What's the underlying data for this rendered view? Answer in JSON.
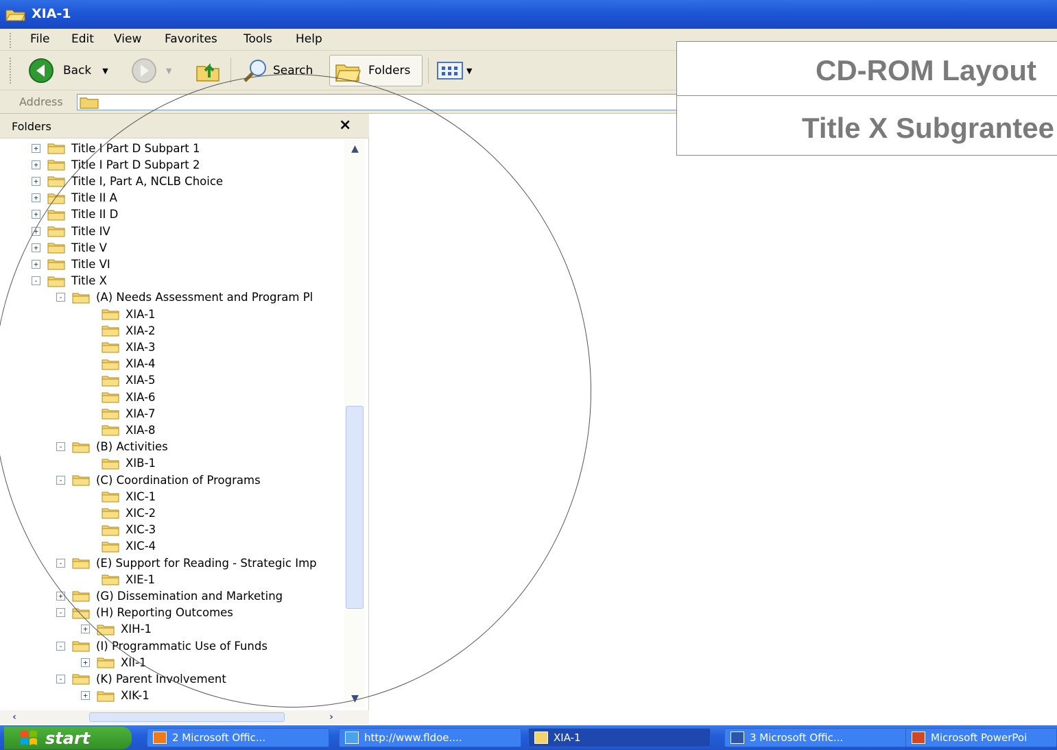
{
  "window": {
    "title": "XIA-1"
  },
  "menu": [
    "File",
    "Edit",
    "View",
    "Favorites",
    "Tools",
    "Help"
  ],
  "toolbar": {
    "back": "Back",
    "search": "Search",
    "folders": "Folders"
  },
  "address": {
    "label": "Address",
    "value": ""
  },
  "folders_pane": {
    "title": "Folders",
    "close": "×"
  },
  "tree": [
    {
      "label": "Title I Part D Subpart 1",
      "level": 0,
      "expander": "+"
    },
    {
      "label": "Title I Part D Subpart 2",
      "level": 0,
      "expander": "+"
    },
    {
      "label": "Title I, Part A, NCLB Choice",
      "level": 0,
      "expander": "+"
    },
    {
      "label": "Title II A",
      "level": 0,
      "expander": "+"
    },
    {
      "label": "Title II D",
      "level": 0,
      "expander": "+"
    },
    {
      "label": "Title IV",
      "level": 0,
      "expander": "+"
    },
    {
      "label": "Title V",
      "level": 0,
      "expander": "+"
    },
    {
      "label": "Title VI",
      "level": 0,
      "expander": "+"
    },
    {
      "label": "Title X",
      "level": 0,
      "expander": "-"
    },
    {
      "label": "(A) Needs Assessment and Program Pl",
      "level": 1,
      "expander": "-"
    },
    {
      "label": "XIA-1",
      "level": 2,
      "expander": ""
    },
    {
      "label": "XIA-2",
      "level": 2,
      "expander": ""
    },
    {
      "label": "XIA-3",
      "level": 2,
      "expander": ""
    },
    {
      "label": "XIA-4",
      "level": 2,
      "expander": ""
    },
    {
      "label": "XIA-5",
      "level": 2,
      "expander": ""
    },
    {
      "label": "XIA-6",
      "level": 2,
      "expander": ""
    },
    {
      "label": "XIA-7",
      "level": 2,
      "expander": ""
    },
    {
      "label": "XIA-8",
      "level": 2,
      "expander": ""
    },
    {
      "label": "(B) Activities",
      "level": 1,
      "expander": "-"
    },
    {
      "label": "XIB-1",
      "level": 2,
      "expander": ""
    },
    {
      "label": "(C) Coordination of Programs",
      "level": 1,
      "expander": "-"
    },
    {
      "label": "XIC-1",
      "level": 2,
      "expander": ""
    },
    {
      "label": "XIC-2",
      "level": 2,
      "expander": ""
    },
    {
      "label": "XIC-3",
      "level": 2,
      "expander": ""
    },
    {
      "label": "XIC-4",
      "level": 2,
      "expander": ""
    },
    {
      "label": "(E) Support for Reading - Strategic Imp",
      "level": 1,
      "expander": "-"
    },
    {
      "label": "XIE-1",
      "level": 2,
      "expander": ""
    },
    {
      "label": "(G) Dissemination and Marketing",
      "level": 1,
      "expander": "+"
    },
    {
      "label": "(H) Reporting Outcomes",
      "level": 1,
      "expander": "-"
    },
    {
      "label": "XIH-1",
      "level": 2,
      "expander": "+"
    },
    {
      "label": "(I) Programmatic Use of Funds",
      "level": 1,
      "expander": "-"
    },
    {
      "label": "XII-1",
      "level": 2,
      "expander": "+"
    },
    {
      "label": "(K) Parent Involvement",
      "level": 1,
      "expander": "-"
    },
    {
      "label": "XIK-1",
      "level": 2,
      "expander": "+"
    }
  ],
  "taskbar": {
    "start": "start",
    "items": [
      {
        "label": "2 Microsoft Offic...",
        "active": false,
        "icon": "office-icon"
      },
      {
        "label": "http://www.fldoe....",
        "active": false,
        "icon": "ie-icon"
      },
      {
        "label": "XIA-1",
        "active": true,
        "icon": "folder-icon"
      },
      {
        "label": "3 Microsoft Offic...",
        "active": false,
        "icon": "word-icon"
      },
      {
        "label": "Microsoft PowerPoi",
        "active": false,
        "icon": "powerpoint-icon"
      }
    ]
  },
  "overlay": {
    "title": "CD-ROM Layout",
    "subtitle": "Title X Subgrantee"
  },
  "colors": {
    "titlebar": "#245edb",
    "menubar": "#ece9d8",
    "overlay_text": "#7a7a7a",
    "folder": "#f3d36c"
  }
}
